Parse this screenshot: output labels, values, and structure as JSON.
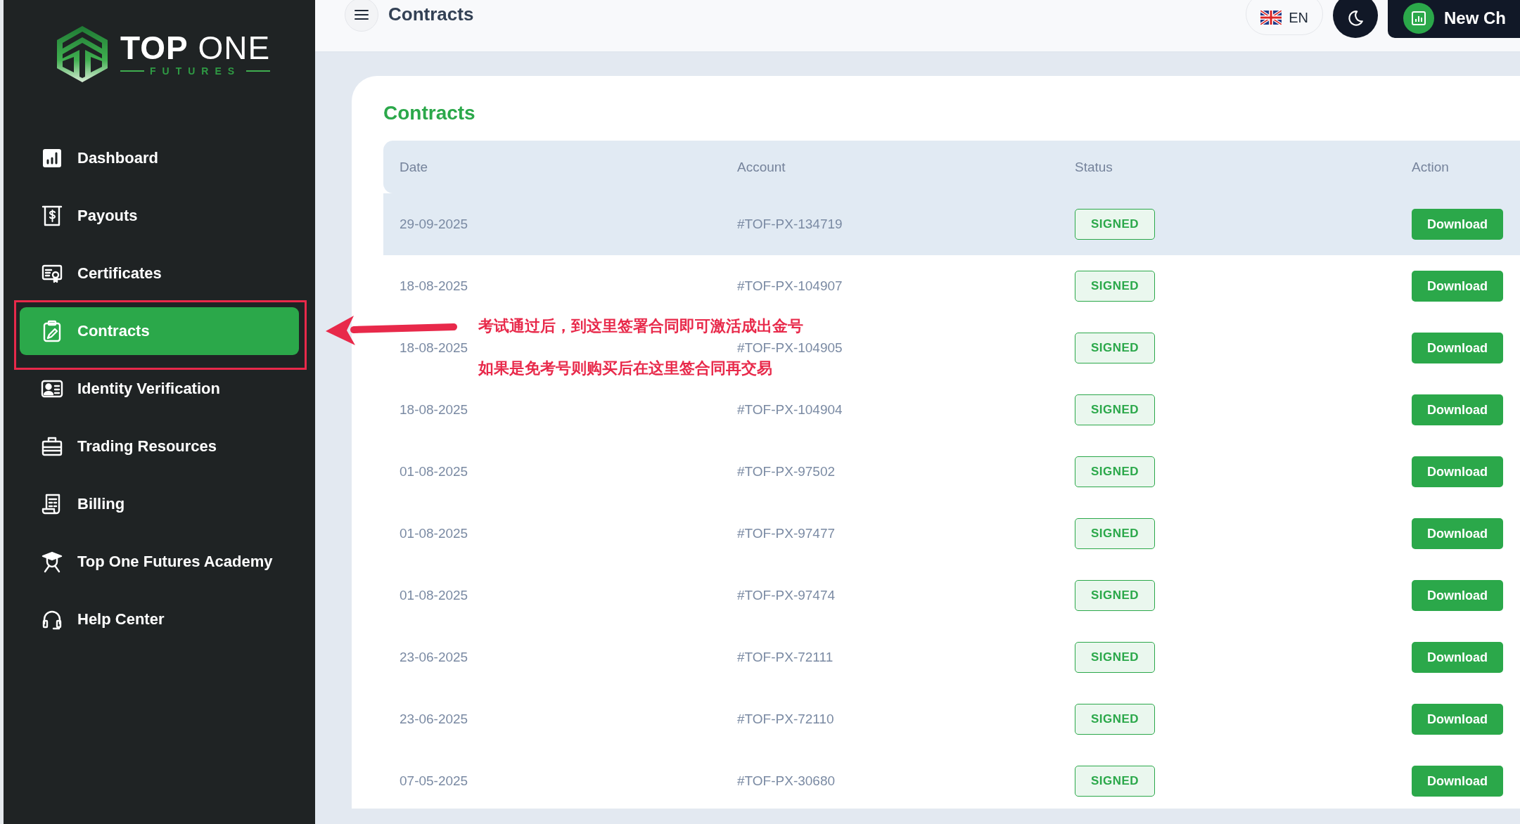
{
  "logo": {
    "title_bold": "TOP",
    "title_light": "ONE",
    "subtitle": "FUTURES"
  },
  "sidebar": {
    "items": [
      {
        "label": "Dashboard",
        "selected": false
      },
      {
        "label": "Payouts",
        "selected": false
      },
      {
        "label": "Certificates",
        "selected": false
      },
      {
        "label": "Contracts",
        "selected": true
      },
      {
        "label": "Identity Verification",
        "selected": false
      },
      {
        "label": "Trading Resources",
        "selected": false
      },
      {
        "label": "Billing",
        "selected": false
      },
      {
        "label": "Top One Futures Academy",
        "selected": false
      },
      {
        "label": "Help Center",
        "selected": false
      }
    ]
  },
  "topbar": {
    "title": "Contracts",
    "language": "EN",
    "new_button": "New Ch"
  },
  "page": {
    "heading": "Contracts"
  },
  "table": {
    "columns": [
      "Date",
      "Account",
      "Status",
      "Action"
    ],
    "rows": [
      {
        "date": "29-09-2025",
        "account": "#TOF-PX-134719",
        "status": "SIGNED",
        "action": "Download",
        "highlighted": true
      },
      {
        "date": "18-08-2025",
        "account": "#TOF-PX-104907",
        "status": "SIGNED",
        "action": "Download",
        "highlighted": false
      },
      {
        "date": "18-08-2025",
        "account": "#TOF-PX-104905",
        "status": "SIGNED",
        "action": "Download",
        "highlighted": false
      },
      {
        "date": "18-08-2025",
        "account": "#TOF-PX-104904",
        "status": "SIGNED",
        "action": "Download",
        "highlighted": false
      },
      {
        "date": "01-08-2025",
        "account": "#TOF-PX-97502",
        "status": "SIGNED",
        "action": "Download",
        "highlighted": false
      },
      {
        "date": "01-08-2025",
        "account": "#TOF-PX-97477",
        "status": "SIGNED",
        "action": "Download",
        "highlighted": false
      },
      {
        "date": "01-08-2025",
        "account": "#TOF-PX-97474",
        "status": "SIGNED",
        "action": "Download",
        "highlighted": false
      },
      {
        "date": "23-06-2025",
        "account": "#TOF-PX-72111",
        "status": "SIGNED",
        "action": "Download",
        "highlighted": false
      },
      {
        "date": "23-06-2025",
        "account": "#TOF-PX-72110",
        "status": "SIGNED",
        "action": "Download",
        "highlighted": false
      },
      {
        "date": "07-05-2025",
        "account": "#TOF-PX-30680",
        "status": "SIGNED",
        "action": "Download",
        "highlighted": false
      }
    ]
  },
  "annotation": {
    "notes": [
      "考试通过后，到这里签署合同即可激活成出金号",
      "如果是免考号则购买后在这里签合同再交易"
    ]
  }
}
